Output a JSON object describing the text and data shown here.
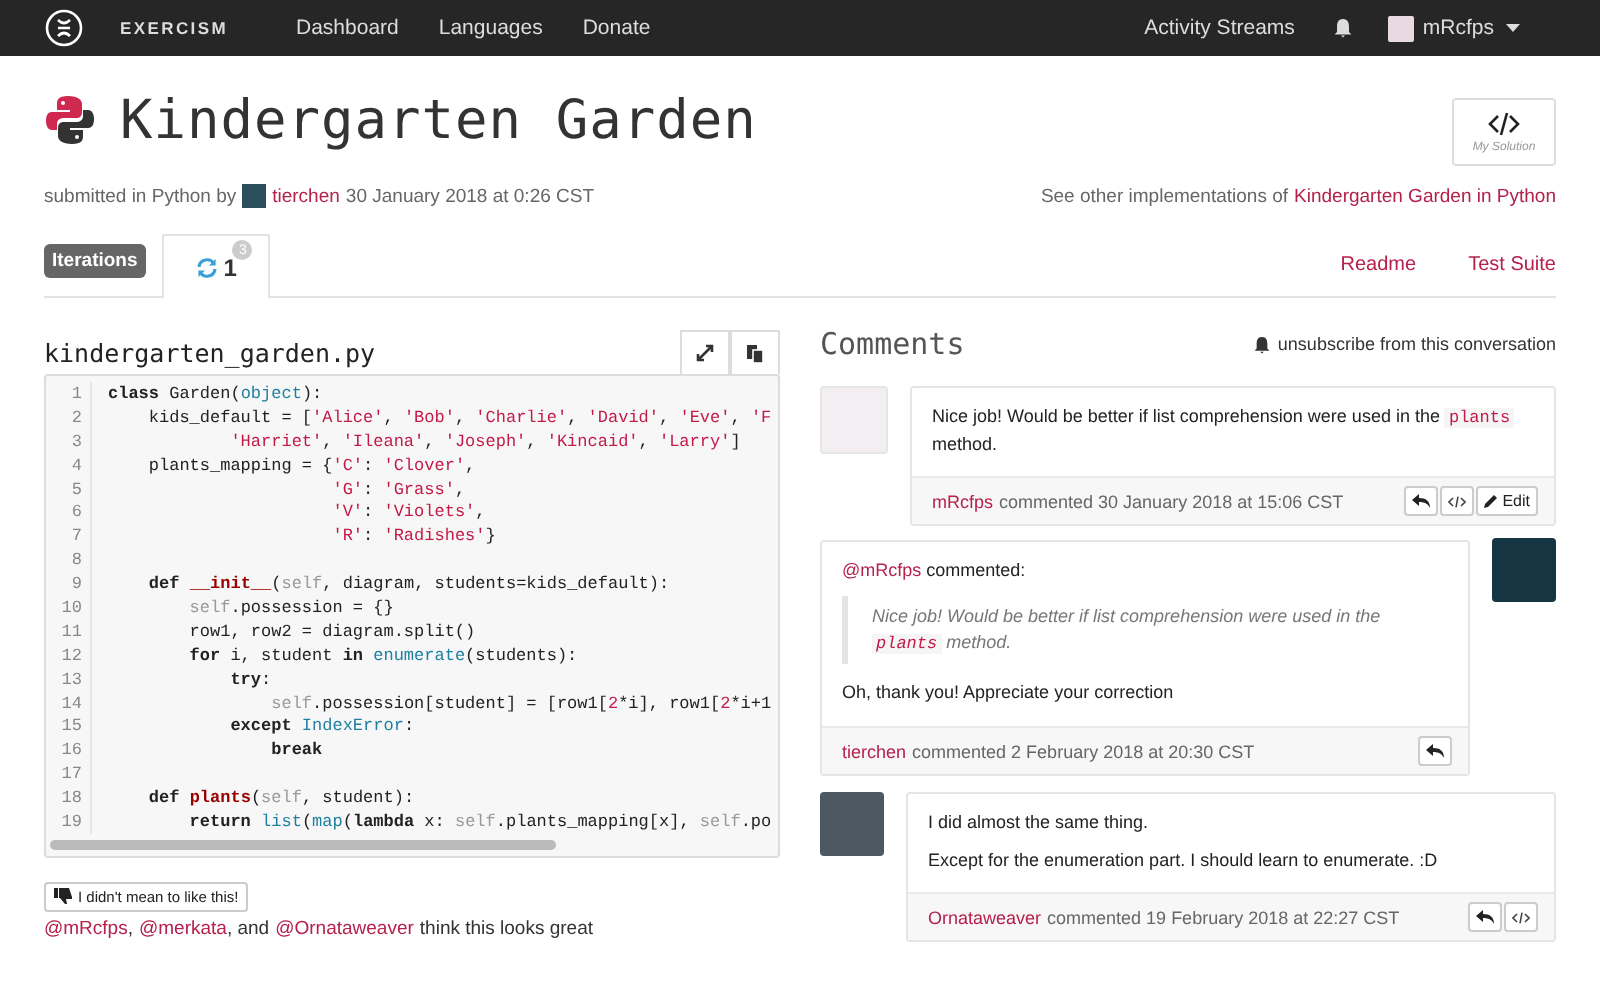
{
  "navbar": {
    "brand": "EXERCISM",
    "links": [
      "Dashboard",
      "Languages",
      "Donate"
    ],
    "activity": "Activity Streams",
    "user": "mRcfps"
  },
  "header": {
    "title": "Kindergarten Garden",
    "submitted_prefix": "submitted in Python by",
    "author": "tierchen",
    "date": "30 January 2018 at 0:26 CST",
    "other_prefix": "See other implementations of",
    "other_link": "Kindergarten Garden in Python",
    "my_solution": "My Solution"
  },
  "tabs": {
    "label": "Iterations",
    "iterations": [
      {
        "number": "1",
        "badge": "3",
        "selected": true
      }
    ],
    "links": [
      "Readme",
      "Test Suite"
    ]
  },
  "file": {
    "name": "kindergarten_garden.py",
    "lines": [
      {
        "number": "1",
        "tokens": [
          {
            "kind": "kw",
            "text": "class"
          },
          {
            "kind": "p",
            "text": " Garden("
          },
          {
            "kind": "bi",
            "text": "object"
          },
          {
            "kind": "p",
            "text": "):"
          }
        ]
      },
      {
        "number": "2",
        "tokens": [
          {
            "kind": "p",
            "text": "    kids_default = ["
          },
          {
            "kind": "s",
            "text": "'Alice'"
          },
          {
            "kind": "p",
            "text": ", "
          },
          {
            "kind": "s",
            "text": "'Bob'"
          },
          {
            "kind": "p",
            "text": ", "
          },
          {
            "kind": "s",
            "text": "'Charlie'"
          },
          {
            "kind": "p",
            "text": ", "
          },
          {
            "kind": "s",
            "text": "'David'"
          },
          {
            "kind": "p",
            "text": ", "
          },
          {
            "kind": "s",
            "text": "'Eve'"
          },
          {
            "kind": "p",
            "text": ", "
          },
          {
            "kind": "s",
            "text": "'F"
          }
        ]
      },
      {
        "number": "3",
        "tokens": [
          {
            "kind": "s",
            "text": "            'Harriet'"
          },
          {
            "kind": "p",
            "text": ", "
          },
          {
            "kind": "s",
            "text": "'Ileana'"
          },
          {
            "kind": "p",
            "text": ", "
          },
          {
            "kind": "s",
            "text": "'Joseph'"
          },
          {
            "kind": "p",
            "text": ", "
          },
          {
            "kind": "s",
            "text": "'Kincaid'"
          },
          {
            "kind": "p",
            "text": ", "
          },
          {
            "kind": "s",
            "text": "'Larry'"
          },
          {
            "kind": "p",
            "text": "]"
          }
        ]
      },
      {
        "number": "4",
        "tokens": [
          {
            "kind": "p",
            "text": "    plants_mapping = {"
          },
          {
            "kind": "s",
            "text": "'C'"
          },
          {
            "kind": "p",
            "text": ": "
          },
          {
            "kind": "s",
            "text": "'Clover'"
          },
          {
            "kind": "p",
            "text": ","
          }
        ]
      },
      {
        "number": "5",
        "tokens": [
          {
            "kind": "s",
            "text": "                      'G'"
          },
          {
            "kind": "p",
            "text": ": "
          },
          {
            "kind": "s",
            "text": "'Grass'"
          },
          {
            "kind": "p",
            "text": ","
          }
        ]
      },
      {
        "number": "6",
        "tokens": [
          {
            "kind": "s",
            "text": "                      'V'"
          },
          {
            "kind": "p",
            "text": ": "
          },
          {
            "kind": "s",
            "text": "'Violets'"
          },
          {
            "kind": "p",
            "text": ","
          }
        ]
      },
      {
        "number": "7",
        "tokens": [
          {
            "kind": "s",
            "text": "                      'R'"
          },
          {
            "kind": "p",
            "text": ": "
          },
          {
            "kind": "s",
            "text": "'Radishes'"
          },
          {
            "kind": "p",
            "text": "}"
          }
        ]
      },
      {
        "number": "8"
      },
      {
        "number": "9",
        "tokens": [
          {
            "kind": "kw",
            "text": "    def"
          },
          {
            "kind": "fn",
            "text": " __init__"
          },
          {
            "kind": "p",
            "text": "("
          },
          {
            "kind": "self",
            "text": "self"
          },
          {
            "kind": "p",
            "text": ", diagram, students=kids_default):"
          }
        ]
      },
      {
        "number": "10",
        "tokens": [
          {
            "kind": "self",
            "text": "        self"
          },
          {
            "kind": "p",
            "text": ".possession = {}"
          }
        ]
      },
      {
        "number": "11",
        "tokens": [
          {
            "kind": "p",
            "text": "        row1, row2 = diagram.split()"
          }
        ]
      },
      {
        "number": "12",
        "tokens": [
          {
            "kind": "kw",
            "text": "        for"
          },
          {
            "kind": "p",
            "text": " i, student "
          },
          {
            "kind": "kw",
            "text": "in"
          },
          {
            "kind": "bi",
            "text": " enumerate"
          },
          {
            "kind": "p",
            "text": "(students):"
          }
        ]
      },
      {
        "number": "13",
        "tokens": [
          {
            "kind": "kw",
            "text": "            try"
          },
          {
            "kind": "p",
            "text": ":"
          }
        ]
      },
      {
        "number": "14",
        "tokens": [
          {
            "kind": "self",
            "text": "                self"
          },
          {
            "kind": "p",
            "text": ".possession[student] = [row1["
          },
          {
            "kind": "n",
            "text": "2"
          },
          {
            "kind": "p",
            "text": "*i], row1["
          },
          {
            "kind": "n",
            "text": "2"
          },
          {
            "kind": "p",
            "text": "*i+1"
          }
        ]
      },
      {
        "number": "15",
        "tokens": [
          {
            "kind": "kw",
            "text": "            except"
          },
          {
            "kind": "bi",
            "text": " IndexError"
          },
          {
            "kind": "p",
            "text": ":"
          }
        ]
      },
      {
        "number": "16",
        "tokens": [
          {
            "kind": "kw",
            "text": "                break"
          }
        ]
      },
      {
        "number": "17"
      },
      {
        "number": "18",
        "tokens": [
          {
            "kind": "kw",
            "text": "    def"
          },
          {
            "kind": "fn",
            "text": " plants"
          },
          {
            "kind": "p",
            "text": "("
          },
          {
            "kind": "self",
            "text": "self"
          },
          {
            "kind": "p",
            "text": ", student):"
          }
        ]
      },
      {
        "number": "19",
        "tokens": [
          {
            "kind": "kw",
            "text": "        return"
          },
          {
            "kind": "bi",
            "text": " list"
          },
          {
            "kind": "p",
            "text": "("
          },
          {
            "kind": "bi",
            "text": "map"
          },
          {
            "kind": "p",
            "text": "("
          },
          {
            "kind": "kw",
            "text": "lambda"
          },
          {
            "kind": "p",
            "text": " x: "
          },
          {
            "kind": "self",
            "text": "self"
          },
          {
            "kind": "p",
            "text": ".plants_mapping[x], "
          },
          {
            "kind": "self",
            "text": "self"
          },
          {
            "kind": "p",
            "text": ".po"
          }
        ]
      }
    ]
  },
  "like": {
    "button": "I didn't mean to like this!",
    "likers": [
      "@mRcfps",
      "@merkata",
      "@Ornataweaver"
    ],
    "sep1": ",",
    "sep2": ", and",
    "suffix": "think this looks great"
  },
  "comments": {
    "title": "Comments",
    "unsubscribe": "unsubscribe from this conversation",
    "items": [
      {
        "kind": "left",
        "paragraphs": [
          [
            {
              "kind": "text",
              "text": "Nice job! Would be better if list comprehension were used in the "
            },
            {
              "kind": "code",
              "text": "plants"
            },
            {
              "kind": "text",
              "text": " method."
            }
          ]
        ],
        "author": "mRcfps",
        "date": "commented 30 January 2018 at 15:06 CST",
        "actions": [
          {
            "kind": "reply"
          },
          {
            "kind": "code"
          },
          {
            "kind": "edit",
            "label": "Edit"
          }
        ]
      },
      {
        "kind": "right",
        "mention": {
          "name": "@mRcfps",
          "text": "commented:"
        },
        "quote": [
          {
            "kind": "text",
            "text": "Nice job! Would be better if list comprehension were used in the "
          },
          {
            "kind": "code",
            "text": "plants"
          },
          {
            "kind": "text",
            "text": " method."
          }
        ],
        "paragraphs": [
          [
            {
              "kind": "text",
              "text": "Oh, thank you! Appreciate your correction"
            }
          ]
        ],
        "author": "tierchen",
        "date": "commented 2 February 2018 at 20:30 CST",
        "actions": [
          {
            "kind": "reply"
          }
        ]
      },
      {
        "kind": "left",
        "paragraphs": [
          [
            {
              "kind": "text",
              "text": "I did almost the same thing."
            }
          ],
          [
            {
              "kind": "text",
              "text": "Except for the enumeration part. I should learn to enumerate. :D"
            }
          ]
        ],
        "author": "Ornataweaver",
        "date": "commented 19 February 2018 at 22:27 CST",
        "actions": [
          {
            "kind": "reply"
          },
          {
            "kind": "code"
          }
        ]
      }
    ]
  }
}
